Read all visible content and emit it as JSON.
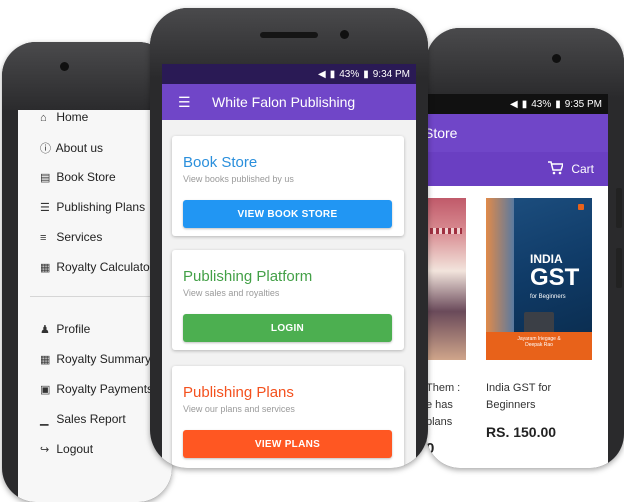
{
  "colors": {
    "primary": "#7046c8",
    "book_store_title": "#2a8fdc",
    "book_store_button": "#2196f3",
    "platform_title": "#43a047",
    "platform_button": "#4caf50",
    "plans_title": "#f4511e",
    "plans_button": "#ff5722"
  },
  "left_drawer": {
    "items": [
      {
        "icon": "home-icon",
        "glyph": "⌂",
        "label": "Home"
      },
      {
        "icon": "info-icon",
        "glyph": "ⓘ",
        "label": "About us"
      },
      {
        "icon": "book-icon",
        "glyph": "▤",
        "label": "Book Store"
      },
      {
        "icon": "list-icon",
        "glyph": "☰",
        "label": "Publishing Plans"
      },
      {
        "icon": "services-icon",
        "glyph": "≡",
        "label": "Services"
      },
      {
        "icon": "calculator-icon",
        "glyph": "▦",
        "label": "Royalty Calculator"
      }
    ],
    "account_items": [
      {
        "icon": "user-icon",
        "glyph": "♟",
        "label": "Profile"
      },
      {
        "icon": "table-icon",
        "glyph": "▦",
        "label": "Royalty Summary"
      },
      {
        "icon": "money-icon",
        "glyph": "▣",
        "label": "Royalty Payments"
      },
      {
        "icon": "bar-chart-icon",
        "glyph": "▁",
        "label": "Sales Report"
      },
      {
        "icon": "logout-icon",
        "glyph": "↪",
        "label": "Logout"
      }
    ]
  },
  "middle_phone": {
    "status": {
      "battery": "43%",
      "time": "9:34 PM"
    },
    "app_title": "White Falon Publishing",
    "cards": [
      {
        "title": "Book Store",
        "subtitle": "View books published by us",
        "button": "VIEW BOOK STORE"
      },
      {
        "title": "Publishing Platform",
        "subtitle": "View sales and royalties",
        "button": "LOGIN"
      },
      {
        "title": "Publishing Plans",
        "subtitle": "View our plans and services",
        "button": "VIEW PLANS"
      }
    ]
  },
  "right_phone": {
    "status": {
      "battery": "43%",
      "time": "9:35 PM"
    },
    "app_title_fragment": "Store",
    "cart_label": "Cart",
    "books": [
      {
        "title_lines": [
          "Them :",
          "e has",
          "plans"
        ],
        "price_fragment": "0"
      },
      {
        "title_lines": [
          "India GST for",
          "Beginners"
        ],
        "price": "RS. 150.00",
        "cover_title": "INDIA",
        "cover_big": "GST",
        "cover_sub": "for Beginners",
        "cover_authors": [
          "Jayaram Iriegage &",
          "Deepak Rao"
        ]
      }
    ]
  }
}
